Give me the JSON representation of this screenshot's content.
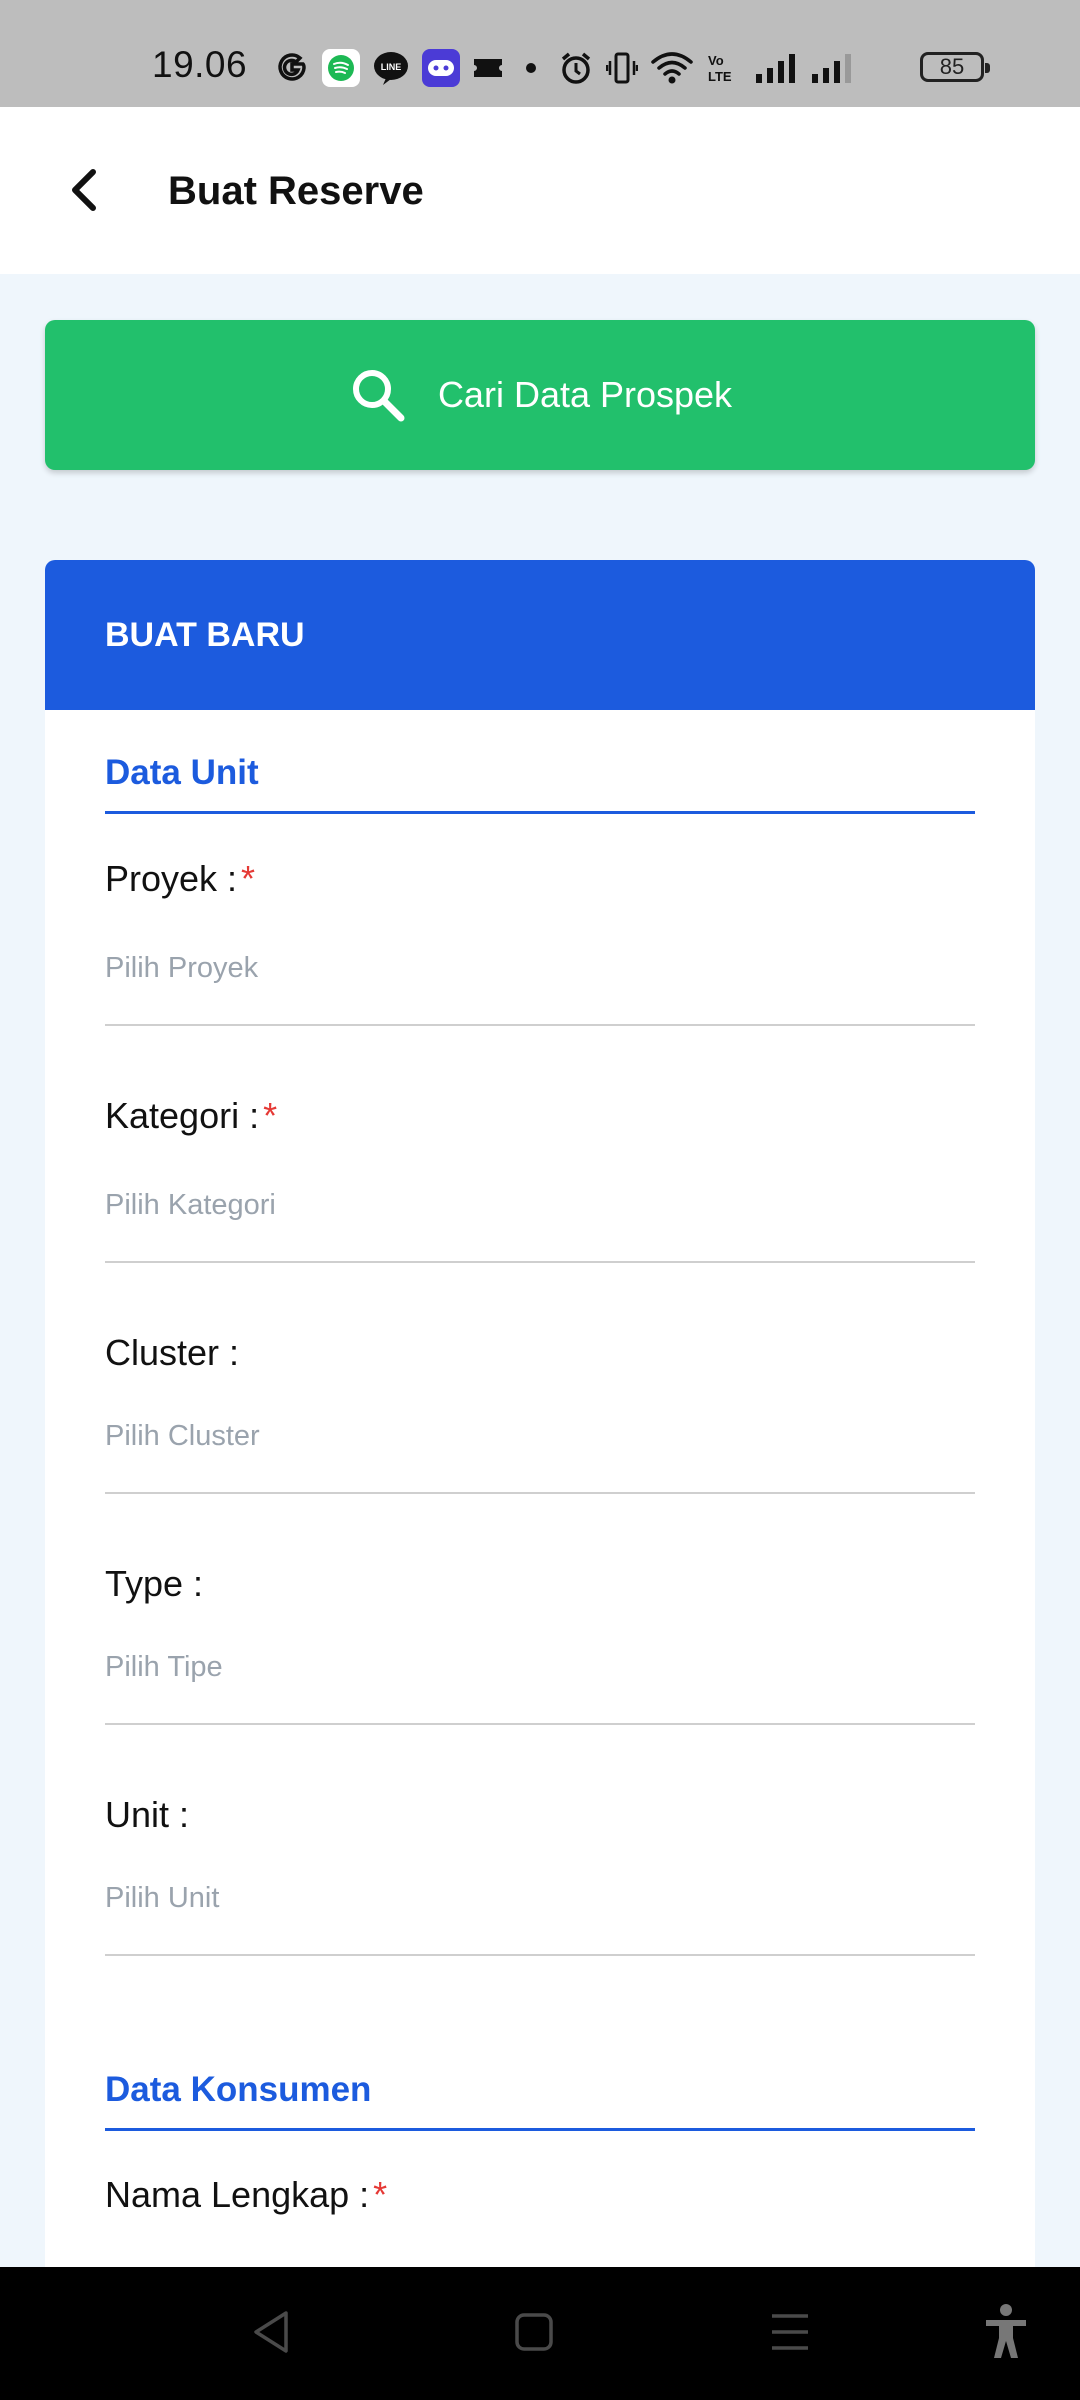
{
  "status_bar": {
    "time": "19.06",
    "battery": "85",
    "icons": [
      "google-icon",
      "spotify-icon",
      "line-icon",
      "game-icon",
      "ticket-icon",
      "dot-icon",
      "alarm-icon",
      "vibrate-icon",
      "wifi-icon",
      "volte-icon",
      "signal-icon",
      "signal-icon"
    ],
    "line_label": "LINE"
  },
  "header": {
    "title": "Buat Reserve",
    "back_icon": "chevron-left-icon"
  },
  "search_button": {
    "label": "Cari Data Prospek",
    "icon": "search-icon"
  },
  "form": {
    "header_title": "BUAT BARU",
    "sections": [
      {
        "title": "Data Unit"
      },
      {
        "title": "Data Konsumen"
      }
    ],
    "fields": [
      {
        "label": "Proyek :",
        "required": "*",
        "placeholder": "Pilih Proyek"
      },
      {
        "label": "Kategori :",
        "required": "*",
        "placeholder": "Pilih Kategori"
      },
      {
        "label": "Cluster :",
        "placeholder": "Pilih Cluster"
      },
      {
        "label": "Type :",
        "placeholder": "Pilih Tipe"
      },
      {
        "label": "Unit :",
        "placeholder": "Pilih Unit"
      },
      {
        "label": "Nama Lengkap :",
        "required": "*"
      }
    ]
  },
  "nav_bar": {
    "icons": [
      "back-triangle-icon",
      "home-square-icon",
      "recents-menu-icon",
      "accessibility-icon"
    ]
  },
  "colors": {
    "primary_blue": "#1c5bde",
    "green": "#22c06c",
    "required_red": "#e53935",
    "background": "#eff6fc"
  }
}
